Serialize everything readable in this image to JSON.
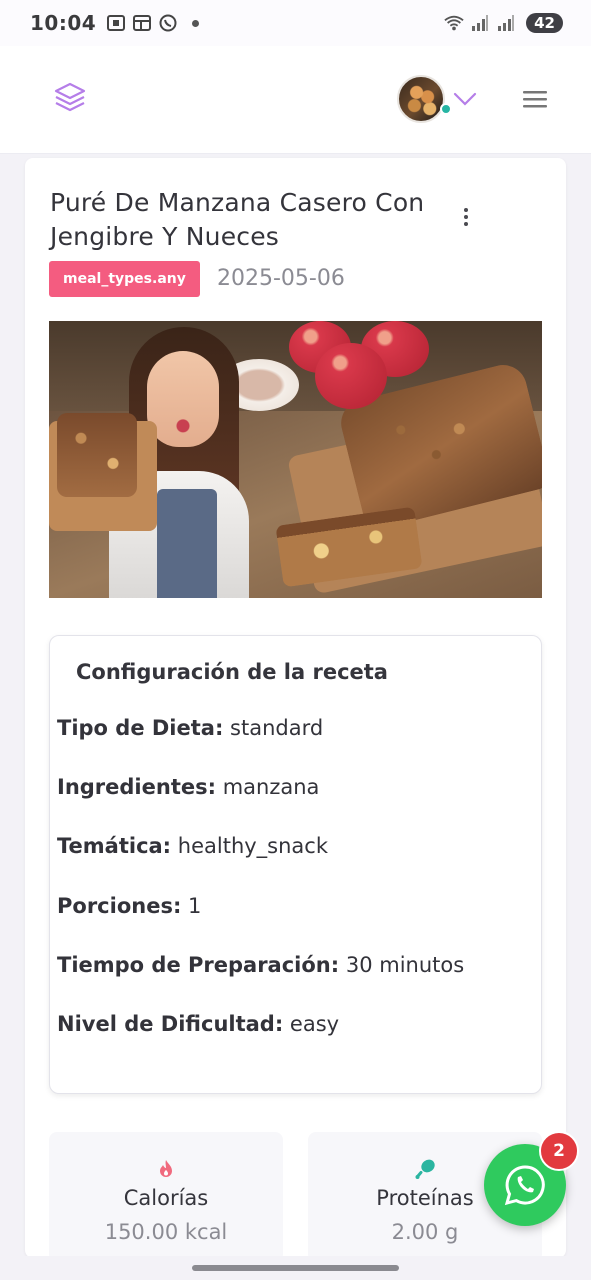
{
  "status_bar": {
    "time": "10:04",
    "battery": "42",
    "icons": [
      "screenshot-icon",
      "window-icon",
      "whatsapp-icon",
      "wifi-icon",
      "signal-icon",
      "signal-icon"
    ]
  },
  "header": {
    "logo_icon": "layers-icon",
    "avatar": "user-avatar",
    "chevron_icon": "chevron-down-icon",
    "menu_icon": "hamburger-icon"
  },
  "recipe": {
    "title": "Puré De Manzana Casero Con Jengibre Y Nueces",
    "badge": "meal_types.any",
    "date": "2025-05-06",
    "image_alt": "recipe-photo"
  },
  "config": {
    "title": "Configuración de la receta",
    "rows": [
      {
        "label": "Tipo de Dieta:",
        "value": "standard"
      },
      {
        "label": "Ingredientes:",
        "value": "manzana"
      },
      {
        "label": "Temática:",
        "value": "healthy_snack"
      },
      {
        "label": "Porciones:",
        "value": "1"
      },
      {
        "label": "Tiempo de Preparación:",
        "value": "30 minutos"
      },
      {
        "label": "Nivel de Dificultad:",
        "value": "easy"
      }
    ]
  },
  "stats": {
    "calories": {
      "label": "Calorías",
      "value": "150.00 kcal",
      "icon": "fire-icon"
    },
    "protein": {
      "label": "Proteínas",
      "value": "2.00 g",
      "icon": "drumstick-icon"
    }
  },
  "whatsapp": {
    "badge": "2"
  },
  "colors": {
    "accent": "#b57ee8",
    "badge": "#f45c80",
    "whatsapp": "#2fca5e",
    "notification": "#e23a3f",
    "online": "#26b5a3"
  }
}
